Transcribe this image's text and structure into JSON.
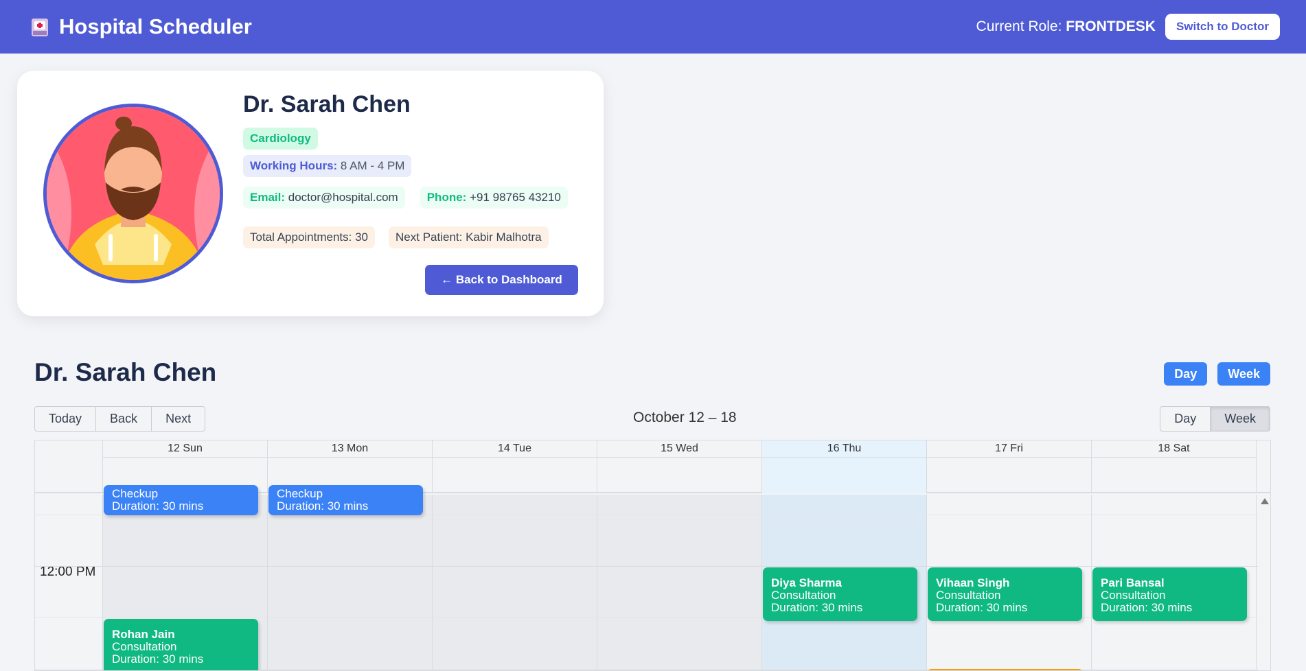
{
  "header": {
    "app_title": "Hospital Scheduler",
    "role_prefix": "Current Role:",
    "role_value": "FRONTDESK",
    "switch_label": "Switch to Doctor"
  },
  "profile": {
    "name": "Dr. Sarah Chen",
    "specialty": "Cardiology",
    "working_hours_label": "Working Hours:",
    "working_hours_value": "8 AM - 4 PM",
    "email_label": "Email:",
    "email_value": "doctor@hospital.com",
    "phone_label": "Phone:",
    "phone_value": "+91 98765 43210",
    "total_appointments": "Total Appointments: 30",
    "next_patient": "Next Patient: Kabir Malhotra",
    "back_label": "← Back to Dashboard"
  },
  "schedule": {
    "title": "Dr. Sarah Chen",
    "view_day": "Day",
    "view_week": "Week",
    "nav_today": "Today",
    "nav_back": "Back",
    "nav_next": "Next",
    "range": "October 12 – 18",
    "toggle_day": "Day",
    "toggle_week": "Week",
    "days": [
      "12 Sun",
      "13 Mon",
      "14 Tue",
      "15 Wed",
      "16 Thu",
      "17 Fri",
      "18 Sat"
    ],
    "time_label": "12:00 PM",
    "events": [
      {
        "name": "",
        "type": "Checkup",
        "duration": "Duration: 30 mins",
        "color": "#3b82f6"
      },
      {
        "name": "",
        "type": "Checkup",
        "duration": "Duration: 30 mins",
        "color": "#3b82f6"
      },
      {
        "name": "Diya Sharma",
        "type": "Consultation",
        "duration": "Duration: 30 mins",
        "color": "#10b981"
      },
      {
        "name": "Vihaan Singh",
        "type": "Consultation",
        "duration": "Duration: 30 mins",
        "color": "#10b981"
      },
      {
        "name": "Pari Bansal",
        "type": "Consultation",
        "duration": "Duration: 30 mins",
        "color": "#10b981"
      },
      {
        "name": "Rohan Jain",
        "type": "Consultation",
        "duration": "Duration: 30 mins",
        "color": "#10b981"
      }
    ]
  },
  "colors": {
    "header_bg": "#4f5bd5",
    "accent_blue": "#3b82f6",
    "accent_green": "#10b981",
    "today_column": "#dceaf5"
  },
  "icons": {
    "brand": "hospital-icon",
    "scroll_up": "arrow-up-icon"
  }
}
